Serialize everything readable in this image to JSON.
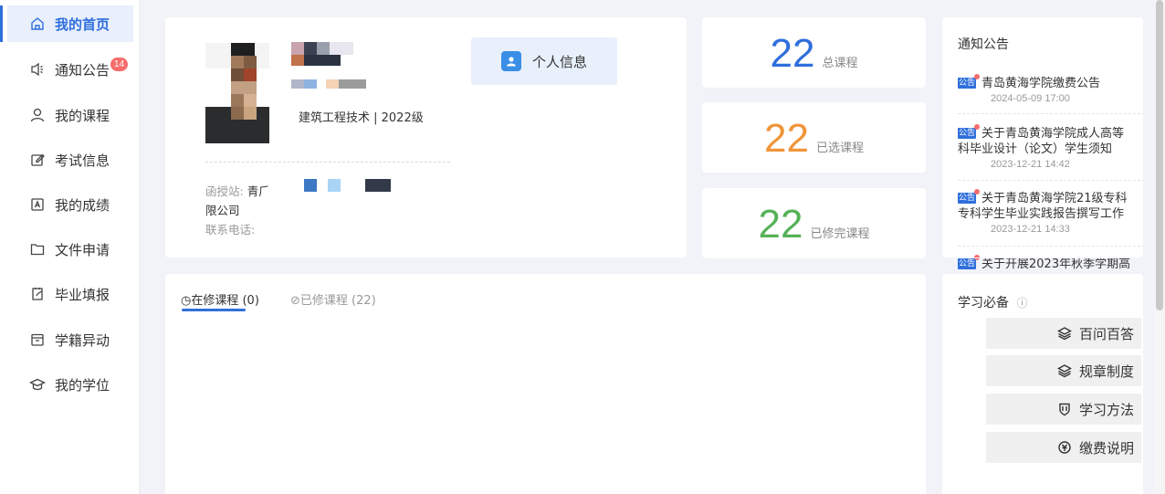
{
  "sidebar": {
    "items": [
      {
        "label": "我的首页",
        "icon": "home-icon",
        "active": true
      },
      {
        "label": "通知公告",
        "icon": "speaker-icon",
        "badge": "14"
      },
      {
        "label": "我的课程",
        "icon": "user-icon"
      },
      {
        "label": "考试信息",
        "icon": "edit-icon"
      },
      {
        "label": "我的成绩",
        "icon": "grade-icon"
      },
      {
        "label": "文件申请",
        "icon": "folder-icon"
      },
      {
        "label": "毕业填报",
        "icon": "form-icon"
      },
      {
        "label": "学籍异动",
        "icon": "calendar-icon"
      },
      {
        "label": "我的学位",
        "icon": "graduation-cap-icon"
      }
    ]
  },
  "profile": {
    "major": "建筑工程技术 | 2022级",
    "station_label": "函授站:",
    "station_value": "青⺁",
    "company": "限公司",
    "phone_label": "联系电话:",
    "info_button": "个人信息"
  },
  "stats": [
    {
      "value": "22",
      "label": "总课程",
      "color": "#2f6fdc"
    },
    {
      "value": "22",
      "label": "已选课程",
      "color": "#f0953a"
    },
    {
      "value": "22",
      "label": "已修完课程",
      "color": "#55b257"
    }
  ],
  "notices": {
    "title": "通知公告",
    "tag": "公告",
    "items": [
      {
        "text": "青岛黄海学院缴费公告",
        "date": "2024-05-09 17:00"
      },
      {
        "text": "关于青岛黄海学院成人高等",
        "text2": "科毕业设计（论文）学生须知",
        "date": "2023-12-21 14:42"
      },
      {
        "text": "关于青岛黄海学院21级专科",
        "text2": "专科学生毕业实践报告撰写工作",
        "date": "2023-12-21 14:33"
      },
      {
        "text": "关于开展2023年秋季学期高"
      }
    ]
  },
  "courses": {
    "tabs": [
      {
        "label": "在修课程 (0)",
        "active": true
      },
      {
        "label": "已修课程 (22)",
        "active": false
      }
    ]
  },
  "study": {
    "title": "学习必备",
    "items": [
      {
        "label": "百问百答",
        "icon": "layers-icon"
      },
      {
        "label": "规章制度",
        "icon": "layers-icon"
      },
      {
        "label": "学习方法",
        "icon": "shield-icon"
      },
      {
        "label": "缴费说明",
        "icon": "coin-icon"
      }
    ]
  }
}
